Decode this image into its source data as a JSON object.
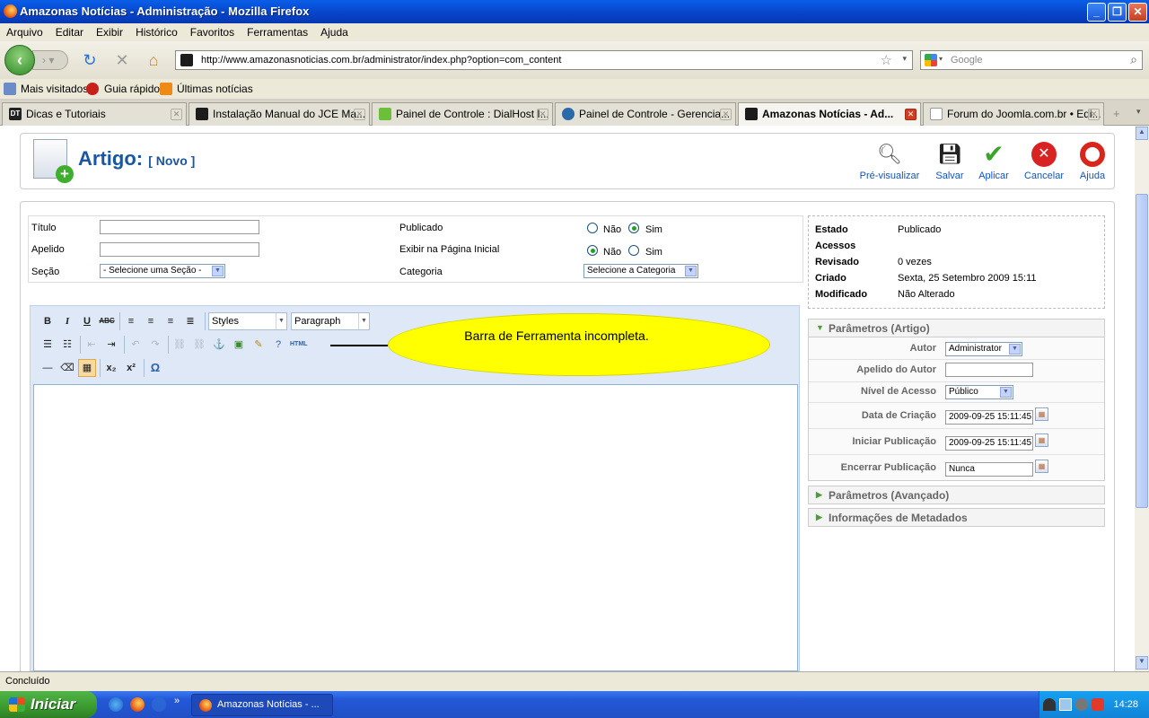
{
  "window": {
    "title": "Amazonas Notícias - Administração - Mozilla Firefox"
  },
  "menu": [
    "Arquivo",
    "Editar",
    "Exibir",
    "Histórico",
    "Favoritos",
    "Ferramentas",
    "Ajuda"
  ],
  "nav": {
    "url": "http://www.amazonasnoticias.com.br/administrator/index.php?option=com_content",
    "search_placeholder": "Google"
  },
  "bookmarks": [
    "Mais visitados",
    "Guia rápido",
    "Últimas notícias"
  ],
  "tabs": [
    {
      "label": "Dicas e Tutoriais",
      "active": false
    },
    {
      "label": "Instalação Manual do JCE Ma...",
      "active": false
    },
    {
      "label": "Painel de Controle : DialHost I...",
      "active": false
    },
    {
      "label": "Painel de Controle - Gerencia...",
      "active": false
    },
    {
      "label": "Amazonas Notícias - Ad...",
      "active": true
    },
    {
      "label": "Forum do Joomla.com.br • Edi...",
      "active": false
    }
  ],
  "page": {
    "heading": "Artigo:",
    "heading_sub": "[ Novo ]",
    "toolbar": [
      "Pré-visualizar",
      "Salvar",
      "Aplicar",
      "Cancelar",
      "Ajuda"
    ]
  },
  "form": {
    "titulo_label": "Título",
    "apelido_label": "Apelido",
    "secao_label": "Seção",
    "secao_value": "- Selecione uma Seção -",
    "publicado_label": "Publicado",
    "exibir_label": "Exibir na Página Inicial",
    "categoria_label": "Categoria",
    "categoria_value": "Selecione a Categoria",
    "nao": "Não",
    "sim": "Sim"
  },
  "editor": {
    "styles": "Styles",
    "format": "Paragraph",
    "note": "Barra de Ferramenta incompleta."
  },
  "status": {
    "estado_k": "Estado",
    "estado_v": "Publicado",
    "acessos_k": "Acessos",
    "acessos_v": "",
    "revisado_k": "Revisado",
    "revisado_v": "0 vezes",
    "criado_k": "Criado",
    "criado_v": "Sexta, 25 Setembro 2009 15:11",
    "modificado_k": "Modificado",
    "modificado_v": "Não Alterado"
  },
  "params": {
    "header": "Parâmetros (Artigo)",
    "autor_label": "Autor",
    "autor_value": "Administrator",
    "apelido_autor_label": "Apelido do Autor",
    "nivel_label": "Nível de Acesso",
    "nivel_value": "Público",
    "data_criacao_label": "Data de Criação",
    "data_criacao_value": "2009-09-25 15:11:45",
    "iniciar_label": "Iniciar Publicação",
    "iniciar_value": "2009-09-25 15:11:45",
    "encerrar_label": "Encerrar Publicação",
    "encerrar_value": "Nunca"
  },
  "panels": [
    "Parâmetros (Avançado)",
    "Informações de Metadados"
  ],
  "statusbar": "Concluído",
  "taskbar": {
    "start": "Iniciar",
    "item": "Amazonas Notícias - ...",
    "clock": "14:28"
  }
}
